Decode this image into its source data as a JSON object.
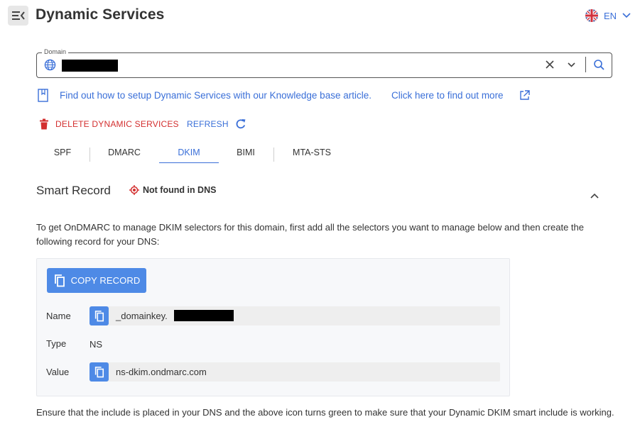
{
  "header": {
    "title": "Dynamic Services",
    "language": "EN",
    "menu_icon": "menu-collapse-icon",
    "flag_icon": "uk-flag-icon"
  },
  "domain_field": {
    "label": "Domain",
    "value": "",
    "icons": [
      "globe-icon",
      "clear-icon",
      "chevron-down-icon",
      "search-icon"
    ]
  },
  "knowledge_base": {
    "text": "Find out how to setup Dynamic Services with our Knowledge base article.",
    "link": "Click here to find out more"
  },
  "actions": {
    "delete_label": "DELETE DYNAMIC SERVICES",
    "refresh_label": "REFRESH"
  },
  "tabs": [
    {
      "label": "SPF",
      "active": false
    },
    {
      "label": "DMARC",
      "active": false
    },
    {
      "label": "DKIM",
      "active": true
    },
    {
      "label": "BIMI",
      "active": false
    },
    {
      "label": "MTA-STS",
      "active": false
    }
  ],
  "smart_record": {
    "title": "Smart Record",
    "status": "Not found in DNS",
    "instructions": "To get OnDMARC to manage DKIM selectors for this domain, first add all the selectors you want to manage below and then create the following record for your DNS:",
    "copy_button": "COPY RECORD",
    "rows": {
      "name": {
        "label": "Name",
        "value": "_domainkey."
      },
      "type": {
        "label": "Type",
        "value": "NS"
      },
      "value": {
        "label": "Value",
        "value": "ns-dkim.ondmarc.com"
      }
    },
    "footer": "Ensure that the include is placed in your DNS and the above icon turns green to make sure that your Dynamic DKIM smart include is working."
  },
  "colors": {
    "accent": "#3a6fd8",
    "button": "#4e8ae6",
    "danger": "#d32f2f"
  }
}
